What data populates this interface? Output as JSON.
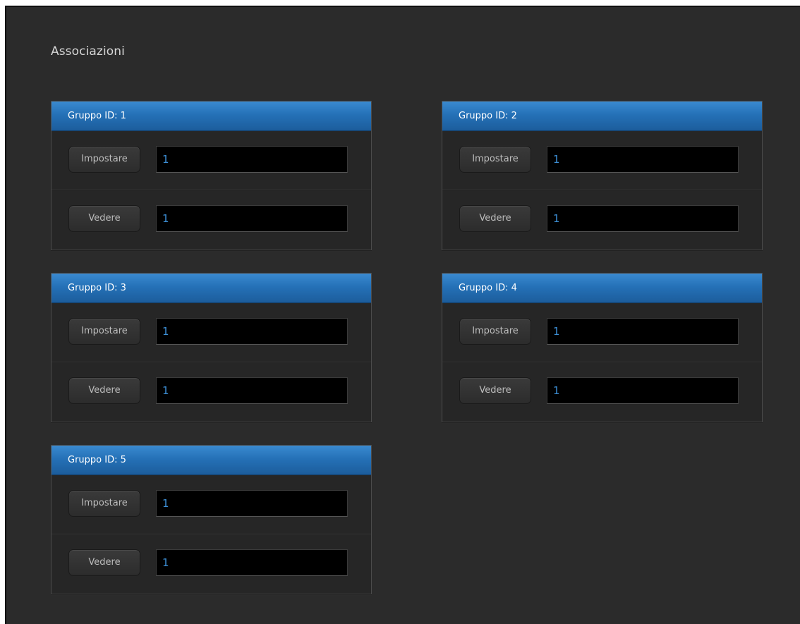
{
  "page": {
    "title": "Associazioni"
  },
  "groups": [
    {
      "header": "Gruppo ID: 1",
      "set_label": "Impostare",
      "set_value": "1",
      "view_label": "Vedere",
      "view_value": "1"
    },
    {
      "header": "Gruppo ID: 2",
      "set_label": "Impostare",
      "set_value": "1",
      "view_label": "Vedere",
      "view_value": "1"
    },
    {
      "header": "Gruppo ID: 3",
      "set_label": "Impostare",
      "set_value": "1",
      "view_label": "Vedere",
      "view_value": "1"
    },
    {
      "header": "Gruppo ID: 4",
      "set_label": "Impostare",
      "set_value": "1",
      "view_label": "Vedere",
      "view_value": "1"
    },
    {
      "header": "Gruppo ID: 5",
      "set_label": "Impostare",
      "set_value": "1",
      "view_label": "Vedere",
      "view_value": "1"
    }
  ],
  "colors": {
    "background": "#2b2b2b",
    "header_blue": "#2571b7",
    "field_text": "#3c8fd6",
    "field_background": "#000000"
  }
}
